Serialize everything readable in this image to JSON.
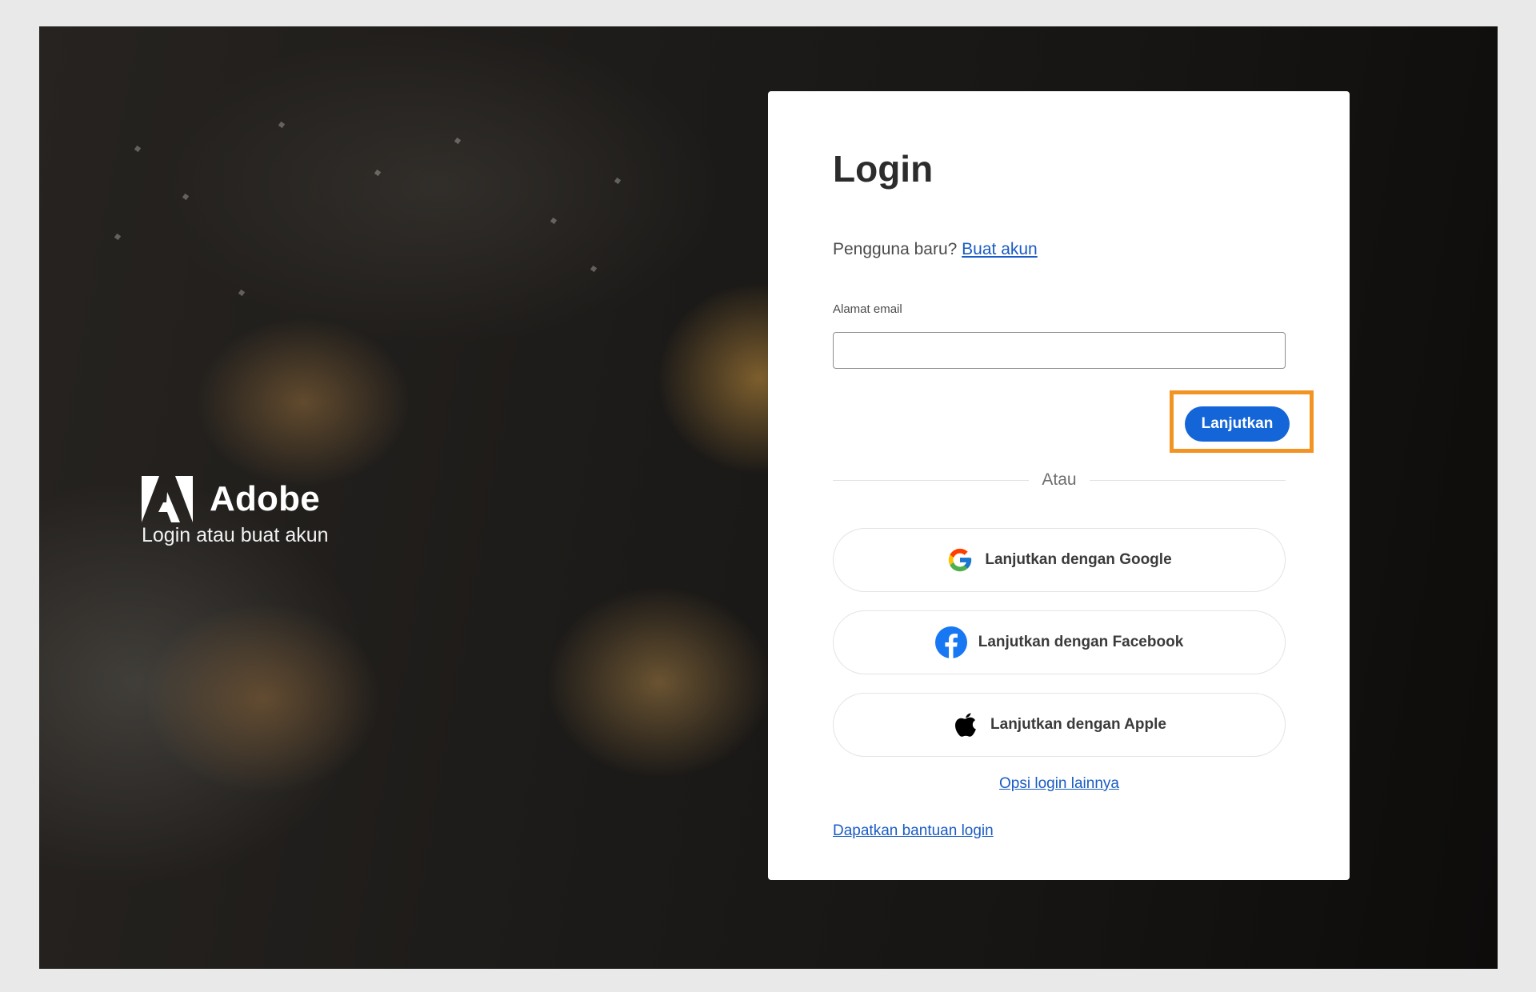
{
  "brand": {
    "name": "Adobe",
    "tagline": "Login atau buat akun"
  },
  "login": {
    "title": "Login",
    "new_user_prompt": "Pengguna baru?",
    "create_account_link": "Buat akun",
    "email_label": "Alamat email",
    "email_value": "",
    "continue_label": "Lanjutkan",
    "divider_text": "Atau",
    "social": {
      "google_label": "Lanjutkan dengan Google",
      "facebook_label": "Lanjutkan dengan Facebook",
      "apple_label": "Lanjutkan dengan Apple"
    },
    "more_options_link": "Opsi login lainnya",
    "help_link": "Dapatkan bantuan login"
  },
  "colors": {
    "primary_button": "#1466d8",
    "link": "#1a5bc4",
    "highlight_border": "#f29423",
    "facebook": "#1877f2"
  },
  "icons": {
    "brand": "adobe-logo-icon",
    "google": "google-icon",
    "facebook": "facebook-icon",
    "apple": "apple-icon"
  }
}
